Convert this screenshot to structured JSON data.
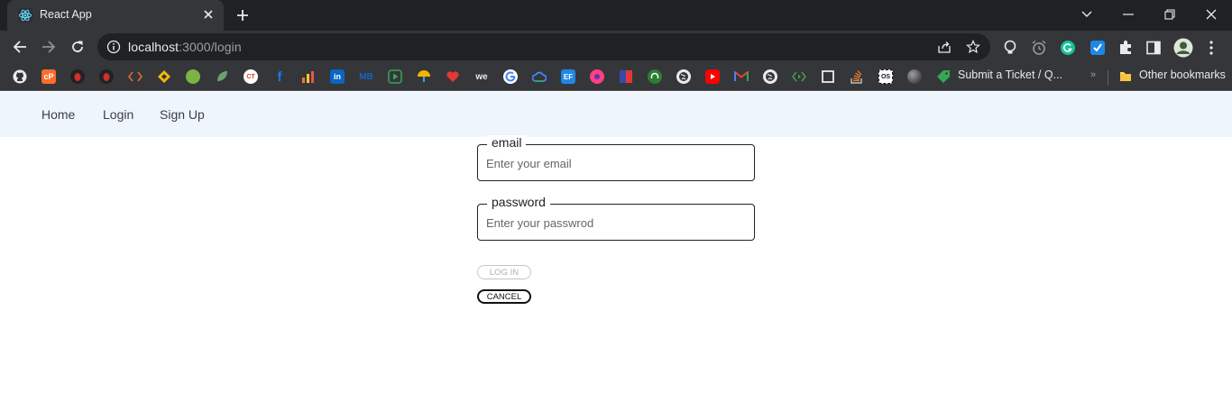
{
  "browser": {
    "tab": {
      "title": "React App",
      "favicon": "react-logo-icon"
    },
    "url": {
      "host": "localhost",
      "path": ":3000/login"
    },
    "bookmarks": {
      "items": [
        {
          "icon": "github-icon",
          "color": "#e8eaed"
        },
        {
          "icon": "cpanel-icon",
          "color": "#ff6c2c"
        },
        {
          "icon": "bug-icon-red",
          "color": "#d32f2f"
        },
        {
          "icon": "bug-icon-red-2",
          "color": "#d32f2f"
        },
        {
          "icon": "code-brackets-icon",
          "color": "#e66b2e"
        },
        {
          "icon": "binance-icon",
          "color": "#f0b90b"
        },
        {
          "icon": "green-circle-icon",
          "color": "#7cb342"
        },
        {
          "icon": "leaf-icon",
          "color": "#6d9f71"
        },
        {
          "icon": "ct-icon",
          "color": "#e53935"
        },
        {
          "icon": "facebook-icon",
          "color": "#1877f2"
        },
        {
          "icon": "chart-icon",
          "color": "#ff7043"
        },
        {
          "icon": "linkedin-icon",
          "color": "#0a66c2"
        },
        {
          "icon": "mb-icon",
          "color": "#1565c0"
        },
        {
          "icon": "play-square-icon",
          "color": "#34a853"
        },
        {
          "icon": "umbrella-icon",
          "color": "#4fc3f7"
        },
        {
          "icon": "heart-tag-icon",
          "color": "#e53935"
        },
        {
          "icon": "we-icon",
          "color": "#e8eaed"
        },
        {
          "icon": "google-icon",
          "color": "#ffffff"
        },
        {
          "icon": "cloud-icon",
          "color": "#4285f4"
        },
        {
          "icon": "ef-icon",
          "color": "#1e88e5"
        },
        {
          "icon": "firefox-icon",
          "color": "#ff4081"
        },
        {
          "icon": "flag-icon",
          "color": "#3949ab"
        },
        {
          "icon": "headset-icon",
          "color": "#2e7d32"
        },
        {
          "icon": "globe-icon",
          "color": "#e8eaed"
        },
        {
          "icon": "youtube-icon",
          "color": "#ff0000"
        },
        {
          "icon": "gmail-icon",
          "color": "#ea4335"
        },
        {
          "icon": "globe-icon-2",
          "color": "#e8eaed"
        },
        {
          "icon": "code-play-icon",
          "color": "#43a047"
        },
        {
          "icon": "square-icon",
          "color": "#e8eaed"
        },
        {
          "icon": "stackoverflow-icon",
          "color": "#f48024"
        },
        {
          "icon": "os-icon",
          "color": "#e8eaed"
        },
        {
          "icon": "sphere-icon",
          "color": "#9e9e9e"
        }
      ],
      "ticket": {
        "icon": "ticket-icon",
        "label": "Submit a Ticket / Q..."
      },
      "overflow": "»",
      "other": {
        "icon": "folder-icon",
        "label": "Other bookmarks"
      }
    }
  },
  "nav": {
    "home": "Home",
    "login": "Login",
    "signup": "Sign Up"
  },
  "form": {
    "email": {
      "label": "email",
      "placeholder": "Enter your email",
      "value": ""
    },
    "password": {
      "label": "password",
      "placeholder": "Enter your passwrod",
      "value": ""
    },
    "login_button": "LOG IN",
    "cancel_button": "CANCEL"
  },
  "colors": {
    "chrome_dark": "#202124",
    "chrome_tab": "#35363a",
    "nav_bg": "#eef5fd"
  }
}
